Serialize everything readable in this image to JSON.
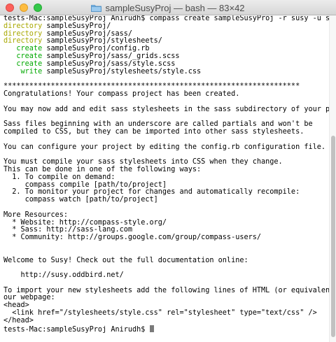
{
  "window": {
    "title": "sampleSusyProj — bash — 83×42"
  },
  "terminal": {
    "lines": [
      {
        "segments": [
          {
            "text": "tests-Mac:sampleSusyProj Anirudh$ compass create sampleSusyProj -r susy -u susy"
          }
        ]
      },
      {
        "segments": [
          {
            "text": "directory",
            "color": "yellow"
          },
          {
            "text": " sampleSusyProj/"
          }
        ]
      },
      {
        "segments": [
          {
            "text": "directory",
            "color": "yellow"
          },
          {
            "text": " sampleSusyProj/sass/"
          }
        ]
      },
      {
        "segments": [
          {
            "text": "directory",
            "color": "yellow"
          },
          {
            "text": " sampleSusyProj/stylesheets/"
          }
        ]
      },
      {
        "segments": [
          {
            "text": "   create",
            "color": "green"
          },
          {
            "text": " sampleSusyProj/config.rb"
          }
        ]
      },
      {
        "segments": [
          {
            "text": "   create",
            "color": "green"
          },
          {
            "text": " sampleSusyProj/sass/_grids.scss"
          }
        ]
      },
      {
        "segments": [
          {
            "text": "   create",
            "color": "green"
          },
          {
            "text": " sampleSusyProj/sass/style.scss"
          }
        ]
      },
      {
        "segments": [
          {
            "text": "    write",
            "color": "green"
          },
          {
            "text": " sampleSusyProj/stylesheets/style.css"
          }
        ]
      },
      {
        "segments": [
          {
            "text": ""
          }
        ]
      },
      {
        "segments": [
          {
            "text": "*********************************************************************"
          }
        ]
      },
      {
        "segments": [
          {
            "text": "Congratulations! Your compass project has been created."
          }
        ]
      },
      {
        "segments": [
          {
            "text": ""
          }
        ]
      },
      {
        "segments": [
          {
            "text": "You may now add and edit sass stylesheets in the sass subdirectory of your project."
          }
        ]
      },
      {
        "segments": [
          {
            "text": ""
          }
        ]
      },
      {
        "segments": [
          {
            "text": "Sass files beginning with an underscore are called partials and won't be"
          }
        ]
      },
      {
        "segments": [
          {
            "text": "compiled to CSS, but they can be imported into other sass stylesheets."
          }
        ]
      },
      {
        "segments": [
          {
            "text": ""
          }
        ]
      },
      {
        "segments": [
          {
            "text": "You can configure your project by editing the config.rb configuration file."
          }
        ]
      },
      {
        "segments": [
          {
            "text": ""
          }
        ]
      },
      {
        "segments": [
          {
            "text": "You must compile your sass stylesheets into CSS when they change."
          }
        ]
      },
      {
        "segments": [
          {
            "text": "This can be done in one of the following ways:"
          }
        ]
      },
      {
        "segments": [
          {
            "text": "  1. To compile on demand:"
          }
        ]
      },
      {
        "segments": [
          {
            "text": "     compass compile [path/to/project]"
          }
        ]
      },
      {
        "segments": [
          {
            "text": "  2. To monitor your project for changes and automatically recompile:"
          }
        ]
      },
      {
        "segments": [
          {
            "text": "     compass watch [path/to/project]"
          }
        ]
      },
      {
        "segments": [
          {
            "text": ""
          }
        ]
      },
      {
        "segments": [
          {
            "text": "More Resources:"
          }
        ]
      },
      {
        "segments": [
          {
            "text": "  * Website: http://compass-style.org/"
          }
        ]
      },
      {
        "segments": [
          {
            "text": "  * Sass: http://sass-lang.com"
          }
        ]
      },
      {
        "segments": [
          {
            "text": "  * Community: http://groups.google.com/group/compass-users/"
          }
        ]
      },
      {
        "segments": [
          {
            "text": ""
          }
        ]
      },
      {
        "segments": [
          {
            "text": ""
          }
        ]
      },
      {
        "segments": [
          {
            "text": "Welcome to Susy! Check out the full documentation online:"
          }
        ]
      },
      {
        "segments": [
          {
            "text": ""
          }
        ]
      },
      {
        "segments": [
          {
            "text": "    http://susy.oddbird.net/"
          }
        ]
      },
      {
        "segments": [
          {
            "text": ""
          }
        ]
      },
      {
        "segments": [
          {
            "text": "To import your new stylesheets add the following lines of HTML (or equivalent) to y"
          }
        ]
      },
      {
        "segments": [
          {
            "text": "our webpage:"
          }
        ]
      },
      {
        "segments": [
          {
            "text": "<head>"
          }
        ]
      },
      {
        "segments": [
          {
            "text": "  <link href=\"/stylesheets/style.css\" rel=\"stylesheet\" type=\"text/css\" />"
          }
        ]
      },
      {
        "segments": [
          {
            "text": "</head>"
          }
        ]
      },
      {
        "segments": [
          {
            "text": "tests-Mac:sampleSusyProj Anirudh$ "
          }
        ],
        "cursor": true
      }
    ]
  }
}
